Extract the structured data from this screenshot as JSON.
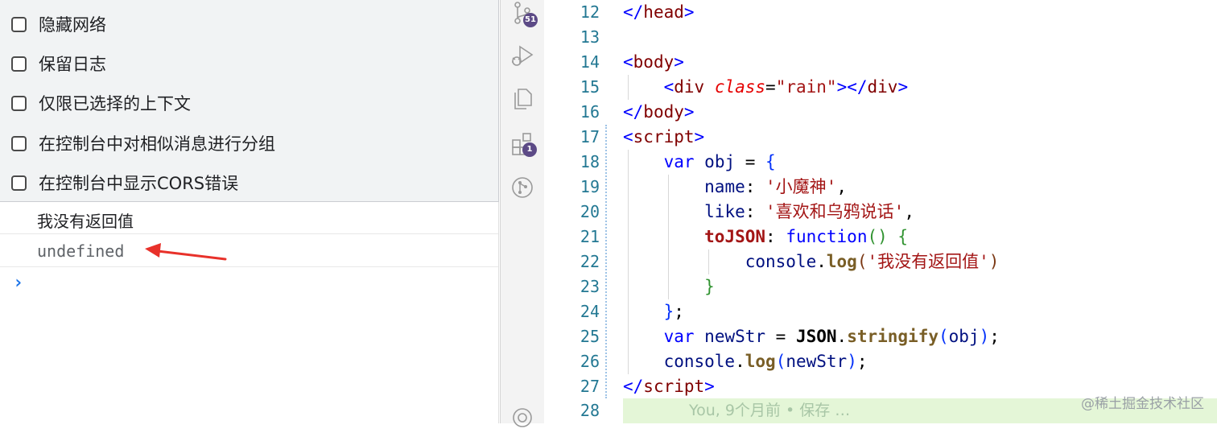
{
  "console_settings": {
    "options": [
      {
        "label": "隐藏网络",
        "checked": false
      },
      {
        "label": "保留日志",
        "checked": false
      },
      {
        "label": "仅限已选择的上下文",
        "checked": false
      },
      {
        "label": "在控制台中对相似消息进行分组",
        "checked": false
      },
      {
        "label": "在控制台中显示CORS错误",
        "checked": false
      }
    ]
  },
  "console_output": {
    "log_message": "我没有返回值",
    "return_value": "undefined",
    "prompt_symbol": "›"
  },
  "activity_bar": {
    "source_control_badge": "51",
    "extensions_badge": "1",
    "icons": [
      "source-control-icon",
      "run-debug-icon",
      "explorer-icon",
      "extensions-icon",
      "git-graph-icon",
      "settings-icon"
    ]
  },
  "editor": {
    "line_numbers": [
      "12",
      "13",
      "14",
      "15",
      "16",
      "17",
      "18",
      "19",
      "20",
      "21",
      "22",
      "23",
      "24",
      "25",
      "26",
      "27",
      "28"
    ],
    "blame_text": "You, 9个月前 • 保存 …",
    "strings": {
      "rain": "\"rain\"",
      "name": "'小魔神'",
      "like": "'喜欢和乌鸦说话'",
      "log": "'我没有返回值'"
    },
    "tokens": {
      "head": "head",
      "body": "body",
      "div": "div",
      "class": "class",
      "script": "script",
      "var": "var",
      "obj": "obj",
      "name": "name",
      "like": "like",
      "toJSON": "toJSON",
      "function": "function",
      "console": "console",
      "log": "log",
      "JSON": "JSON",
      "stringify": "stringify",
      "newStr": "newStr"
    }
  },
  "watermark": "@稀土掘金技术社区"
}
